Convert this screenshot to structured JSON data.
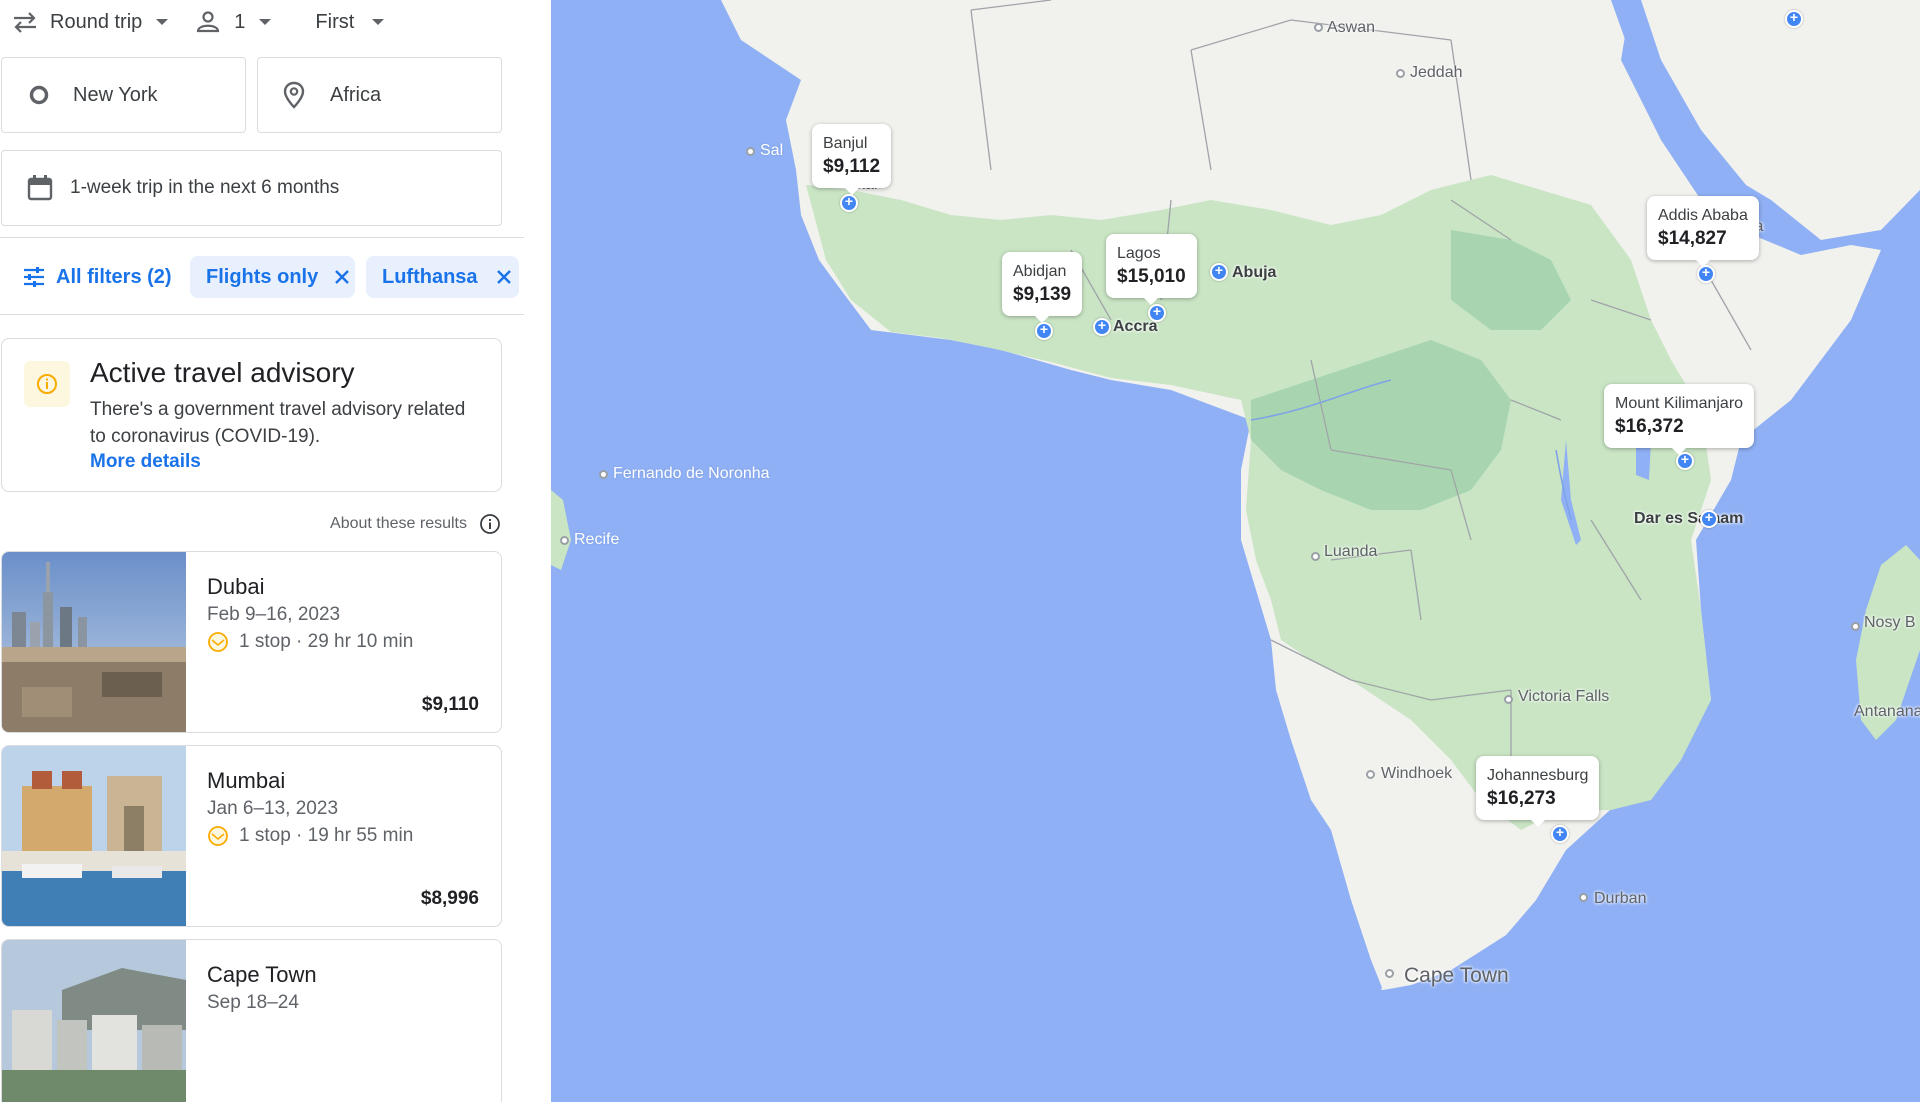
{
  "search": {
    "trip_type": "Round trip",
    "passengers": "1",
    "cabin": "First",
    "origin": "New York",
    "destination": "Africa",
    "dates": "1-week trip in the next 6 months"
  },
  "filters": {
    "all_filters": "All filters (2)",
    "chips": [
      "Flights only",
      "Lufthansa"
    ]
  },
  "advisory": {
    "title": "Active travel advisory",
    "text": "There's a government travel advisory related to coronavirus (COVID-19).",
    "link": "More details"
  },
  "about_results": "About these results",
  "results": [
    {
      "city": "Dubai",
      "dates": "Feb 9–16, 2023",
      "stops": "1 stop · 29 hr 10 min",
      "price": "$9,110",
      "thumb": "city-skyline"
    },
    {
      "city": "Mumbai",
      "dates": "Jan 6–13, 2023",
      "stops": "1 stop · 19 hr 55 min",
      "price": "$8,996",
      "thumb": "gateway-of-india"
    },
    {
      "city": "Cape Town",
      "dates": "Sep 18–24",
      "stops": "",
      "price": "",
      "thumb": "table-mountain"
    }
  ],
  "map": {
    "price_pins": [
      {
        "name": "Banjul",
        "price": "$9,112"
      },
      {
        "name": "Abidjan",
        "price": "$9,139"
      },
      {
        "name": "Lagos",
        "price": "$15,010"
      },
      {
        "name": "Addis Ababa",
        "price": "$14,827"
      },
      {
        "name": "Mount Kilimanjaro",
        "price": "$16,372"
      },
      {
        "name": "Johannesburg",
        "price": "$16,273"
      }
    ],
    "labels": {
      "aswan": "Aswan",
      "jeddah": "Jeddah",
      "sal": "Sal",
      "abuja": "Abuja",
      "accra": "Accra",
      "fernando": "Fernando de Noronha",
      "recife": "Recife",
      "luanda": "Luanda",
      "dar": "Dar es Salaam",
      "nosy": "Nosy B",
      "antanana": "Antanana",
      "victoria": "Victoria Falls",
      "windhoek": "Windhoek",
      "durban": "Durban",
      "capetown": "Cape Town",
      "la": "la",
      "kar": "kar"
    },
    "colors": {
      "ocean": "#8fb0f5",
      "desert": "#f1f1ee",
      "forest": "#a8d5b0",
      "savanna": "#c9e5c4",
      "accent": "#1a73e8"
    }
  }
}
